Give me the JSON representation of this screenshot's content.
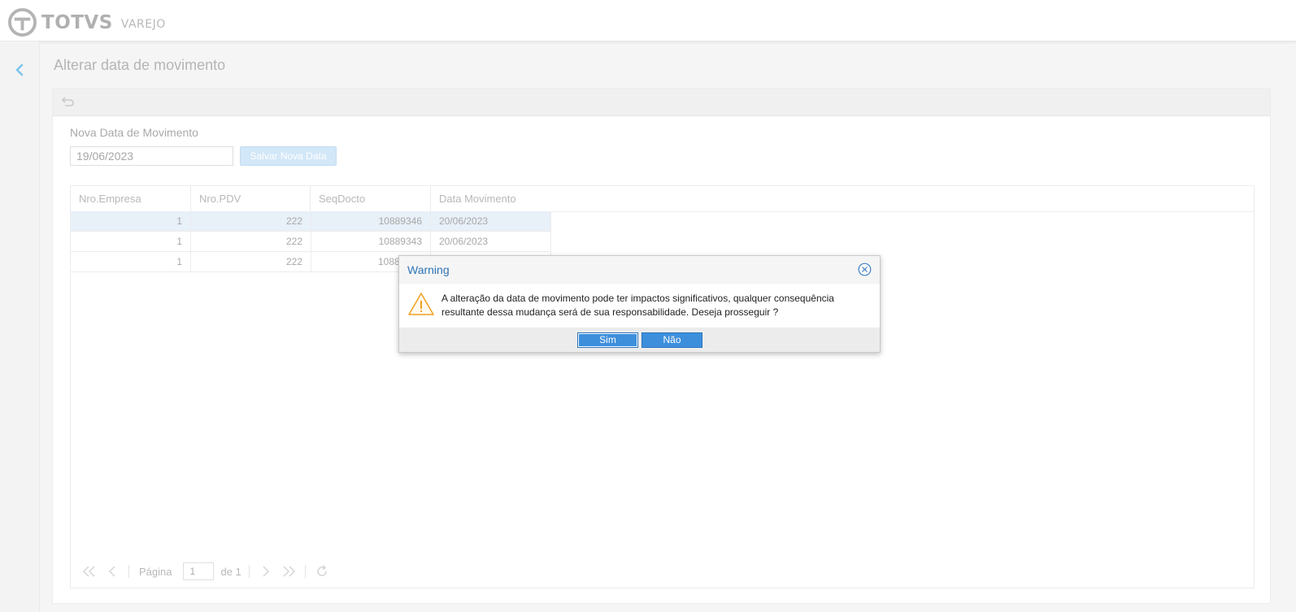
{
  "brand": {
    "name": "TOTVS",
    "product": "VAREJO"
  },
  "page": {
    "title": "Alterar data de movimento"
  },
  "form": {
    "label": "Nova Data de Movimento",
    "date_value": "19/06/2023",
    "save_label": "Salvar Nova Data"
  },
  "table": {
    "columns": [
      "Nro.Empresa",
      "Nro.PDV",
      "SeqDocto",
      "Data Movimento"
    ],
    "rows": [
      [
        "1",
        "222",
        "10889346",
        "20/06/2023"
      ],
      [
        "1",
        "222",
        "10889343",
        "20/06/2023"
      ],
      [
        "1",
        "222",
        "1088",
        ""
      ]
    ]
  },
  "pager": {
    "page_label": "Página",
    "page_value": "1",
    "of_label": "de 1"
  },
  "dialog": {
    "title": "Warning",
    "message": "A alteração da data de movimento pode ter impactos significativos, qualquer consequência resultante dessa mudança será de sua responsabilidade. Deseja prosseguir ?",
    "yes_label": "Sim",
    "no_label": "Não"
  },
  "colors": {
    "accent": "#3d8fdc",
    "title_blue": "#2f74b5",
    "warning": "#f0a020"
  }
}
